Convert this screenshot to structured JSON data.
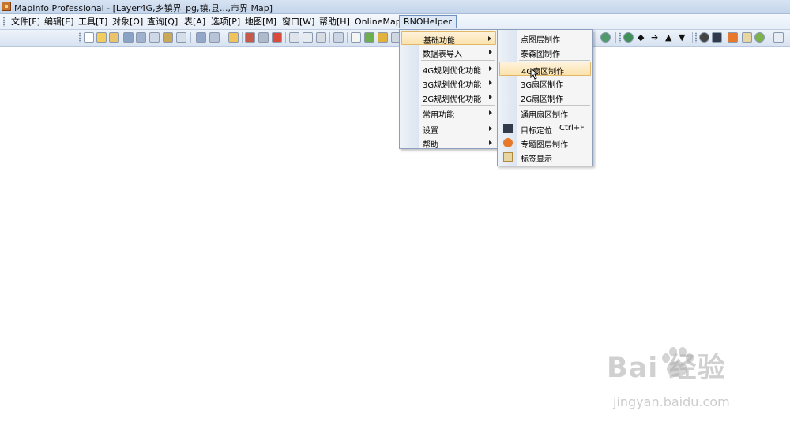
{
  "window": {
    "title": "MapInfo Professional - [Layer4G,乡镇界_pg,镇,县...,市界 Map]"
  },
  "menubar": [
    {
      "id": "file",
      "label": "文件[F]"
    },
    {
      "id": "edit",
      "label": "编辑[E]"
    },
    {
      "id": "tools",
      "label": "工具[T]"
    },
    {
      "id": "objects",
      "label": "对象[O]"
    },
    {
      "id": "query",
      "label": "查询[Q]"
    },
    {
      "id": "table",
      "label": "表[A]"
    },
    {
      "id": "options",
      "label": "选项[P]"
    },
    {
      "id": "map",
      "label": "地图[M]"
    },
    {
      "id": "window",
      "label": "窗口[W]"
    },
    {
      "id": "help",
      "label": "帮助[H]"
    },
    {
      "id": "onlinemap",
      "label": "OnlineMap"
    },
    {
      "id": "rnohelper",
      "label": "RNOHelper",
      "active": true
    }
  ],
  "rnohelper_menu": [
    {
      "label": "基础功能",
      "submenu": true,
      "highlighted": true
    },
    {
      "label": "数据表导入",
      "submenu": true
    },
    {
      "label": "4G规划优化功能",
      "submenu": true
    },
    {
      "label": "3G规划优化功能",
      "submenu": true
    },
    {
      "label": "2G规划优化功能",
      "submenu": true
    },
    {
      "label": "常用功能",
      "submenu": true
    },
    {
      "label": "设置",
      "submenu": true
    },
    {
      "label": "帮助",
      "submenu": true
    }
  ],
  "basic_submenu": [
    {
      "label": "点图层制作"
    },
    {
      "label": "泰森图制作"
    },
    {
      "label": "4G扇区制作",
      "highlighted": true
    },
    {
      "label": "3G扇区制作"
    },
    {
      "label": "2G扇区制作"
    },
    {
      "label": "通用扇区制作"
    },
    {
      "label": "目标定位",
      "shortcut": "Ctrl+F",
      "icon": "target-icon"
    },
    {
      "label": "专题图层制作",
      "icon": "theme-map-icon"
    },
    {
      "label": "标签显示",
      "icon": "label-tag-icon"
    }
  ],
  "watermark": {
    "brand": "Bai 经验",
    "url": "jingyan.baidu.com"
  },
  "colors": {
    "menu_highlight": "#fbe3ad",
    "menu_border": "#8c9fbe"
  }
}
